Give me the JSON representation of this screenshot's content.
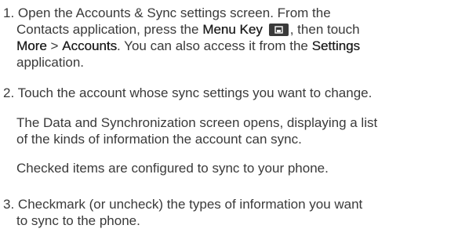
{
  "step1": {
    "number": "1.",
    "t1": "Open the Accounts & Sync settings screen. From the",
    "t2": "Contacts application, press the ",
    "menu_key": "Menu Key",
    "t3": ", then touch",
    "more": "More",
    "gt": " > ",
    "accounts": "Accounts",
    "t4": ". You can also access it from the ",
    "settings": "Settings",
    "t5": "application."
  },
  "step2": {
    "number": "2.",
    "text": "Touch the account whose sync settings you want to change.",
    "para1_line1": "The Data and Synchronization screen opens, displaying a list",
    "para1_line2": "of the kinds of information the account can sync.",
    "para2": "Checked items are configured to sync to your phone."
  },
  "step3": {
    "number": "3.",
    "line1": "Checkmark (or uncheck) the types of information you want",
    "line2": "to sync to the phone."
  },
  "icons": {
    "menu_key": "menu-key-icon"
  }
}
